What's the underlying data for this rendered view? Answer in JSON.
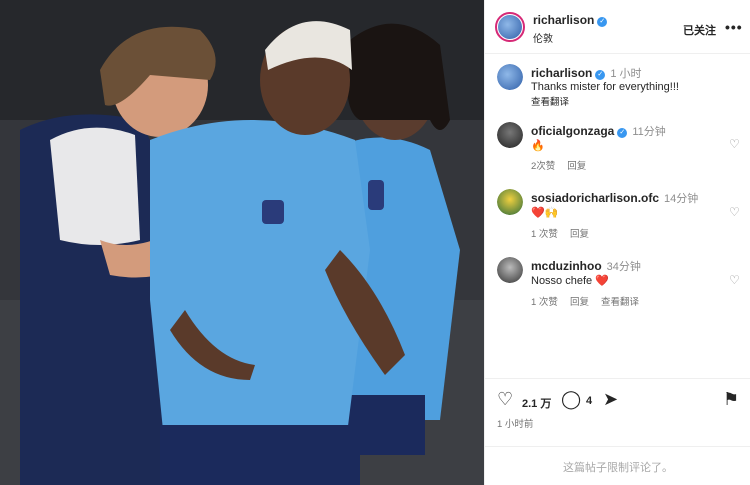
{
  "post": {
    "author": "richarlison",
    "location": "伦敦",
    "follow_label": "已关注",
    "more_label": "•••"
  },
  "caption": {
    "author": "richarlison",
    "time": "1 小时",
    "text": "Thanks mister for everything!!!",
    "translate_label": "查看翻译"
  },
  "comments": [
    {
      "author": "oficialgonzaga",
      "verified": true,
      "time": "11分钟",
      "text": "🔥",
      "likes": "2次赞",
      "reply": "回复",
      "translate": ""
    },
    {
      "author": "sosiadoricharlison.ofc",
      "verified": false,
      "time": "14分钟",
      "text": "❤️🙌",
      "likes": "1 次赞",
      "reply": "回复",
      "translate": ""
    },
    {
      "author": "mcduzinhoo",
      "verified": false,
      "time": "34分钟",
      "text": "Nosso chefe ❤️",
      "likes": "1 次赞",
      "reply": "回复",
      "translate": "查看翻译"
    }
  ],
  "actions": {
    "like_count": "2.1 万",
    "comment_count": "4",
    "post_time": "1 小时前"
  },
  "footer": {
    "limited_text": "这篇帖子限制评论了。"
  },
  "colors": {
    "verified": "#3897f0",
    "muted": "#737373",
    "jersey": "#5aa6e0",
    "coach_shirt": "#1c2a55"
  }
}
